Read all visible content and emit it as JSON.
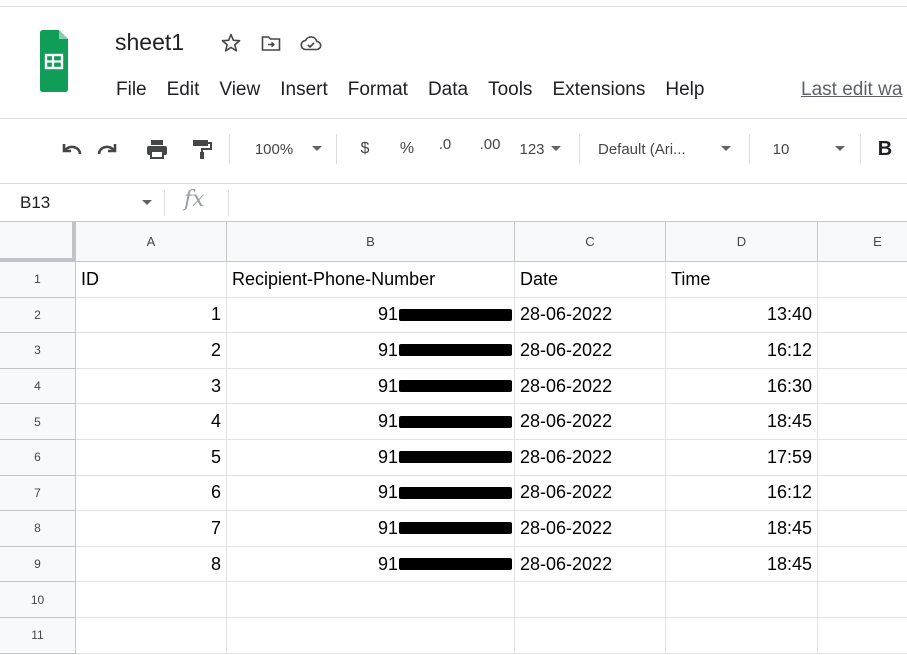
{
  "document": {
    "title": "sheet1",
    "icons": [
      "star-icon",
      "move-to-folder-icon",
      "cloud-status-icon"
    ]
  },
  "menu": [
    "File",
    "Edit",
    "View",
    "Insert",
    "Format",
    "Data",
    "Tools",
    "Extensions",
    "Help"
  ],
  "last_edit": "Last edit wa",
  "toolbar": {
    "zoom": "100%",
    "currency": "$",
    "percent": "%",
    "decrease_decimal": ".0",
    "increase_decimal": ".00",
    "number_format": "123",
    "font": "Default (Ari...",
    "font_size": "10",
    "bold": "B"
  },
  "formula_bar": {
    "cell_ref": "B13",
    "fx_label": "fx",
    "content": ""
  },
  "grid": {
    "columns": [
      "A",
      "B",
      "C",
      "D",
      "E"
    ],
    "row_numbers": [
      "1",
      "2",
      "3",
      "4",
      "5",
      "6",
      "7",
      "8",
      "9",
      "10",
      "11"
    ],
    "header_row": [
      "ID",
      "Recipient-Phone-Number",
      "Date",
      "Time",
      ""
    ],
    "rows": [
      {
        "id": "1",
        "phone": "91",
        "date": "28-06-2022",
        "time": "13:40"
      },
      {
        "id": "2",
        "phone": "91",
        "date": "28-06-2022",
        "time": "16:12"
      },
      {
        "id": "3",
        "phone": "91",
        "date": "28-06-2022",
        "time": "16:30"
      },
      {
        "id": "4",
        "phone": "91",
        "date": "28-06-2022",
        "time": "18:45"
      },
      {
        "id": "5",
        "phone": "91",
        "date": "28-06-2022",
        "time": "17:59"
      },
      {
        "id": "6",
        "phone": "91",
        "date": "28-06-2022",
        "time": "16:12"
      },
      {
        "id": "7",
        "phone": "91",
        "date": "28-06-2022",
        "time": "18:45"
      },
      {
        "id": "8",
        "phone": "91",
        "date": "28-06-2022",
        "time": "18:45"
      }
    ]
  },
  "colors": {
    "sheets_green": "#0f9d58",
    "header_bg": "#f8f9fa",
    "grid_line": "#e2e3e3",
    "redaction": "#000000"
  }
}
